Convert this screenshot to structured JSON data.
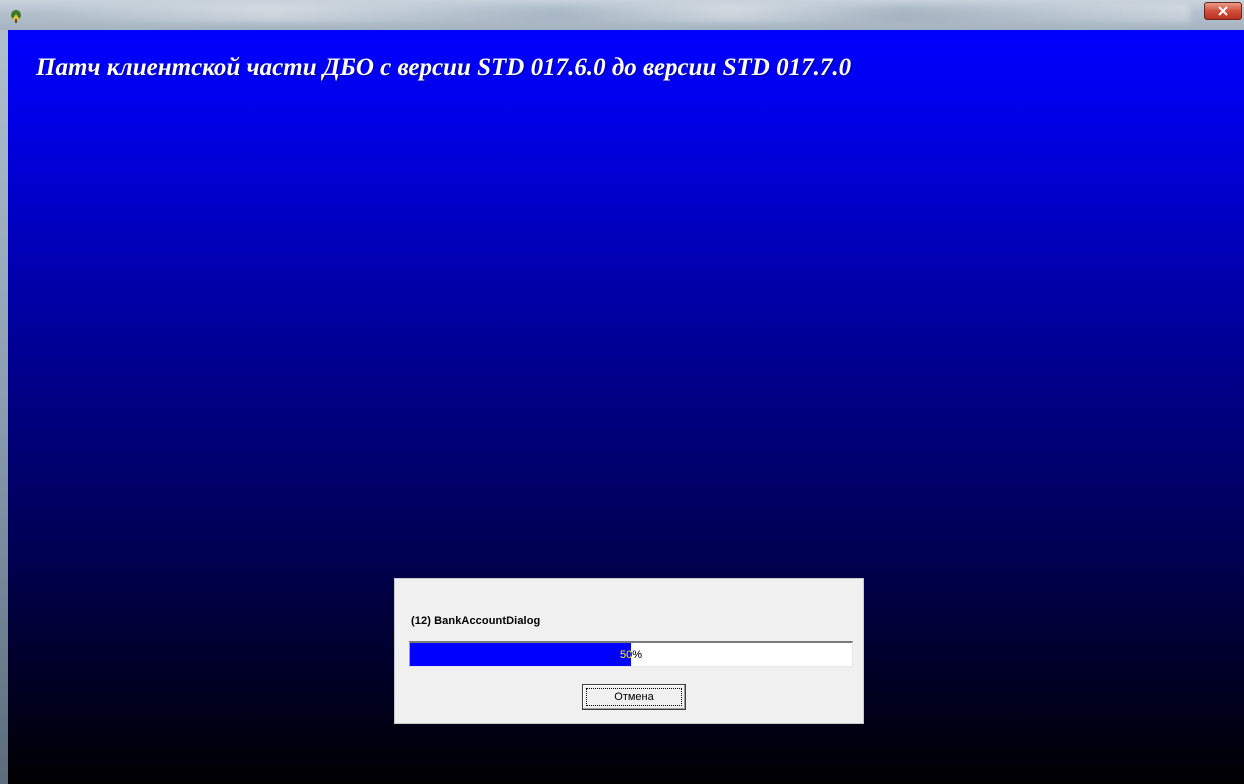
{
  "window": {
    "title": "",
    "app_icon": "setup-app-icon",
    "close_icon": "close-icon"
  },
  "banner": {
    "title": "Патч клиентской части ДБО с версии STD 017.6.0 до версии STD 017.7.0"
  },
  "dialog": {
    "status_text": "(12) BankAccountDialog",
    "progress": {
      "fraction": 0.5,
      "label": "50%"
    },
    "cancel_label": "Отмена"
  },
  "colors": {
    "background_top": "#0000ff",
    "background_bottom": "#000000",
    "progress_fill": "#0000ff",
    "close_button": "#c8402e"
  }
}
